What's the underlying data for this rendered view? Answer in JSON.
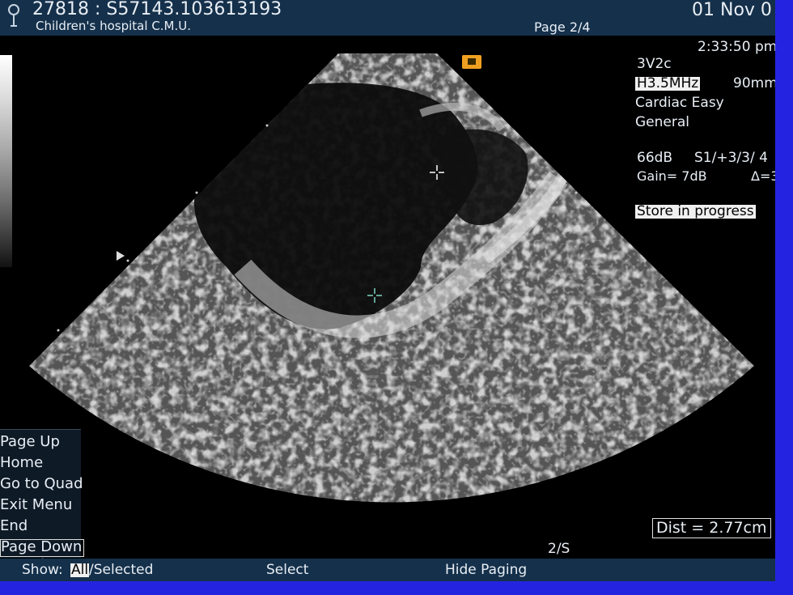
{
  "header": {
    "patient_id": "27818 : S57143.103613193",
    "institution": "Children's hospital  C.M.U.",
    "page": "Page 2/4",
    "date": "01 Nov 0",
    "time": "2:33:50 pm"
  },
  "settings": {
    "probe": "3V2c",
    "freq": "H3.5MHz",
    "depth": "90mm",
    "preset": "Cardiac Easy",
    "mode": "General",
    "db": "66dB",
    "s_param": "S1/+3/3/ 4",
    "gain": "Gain=  7dB",
    "delta": "Δ=3",
    "store": "Store in progress"
  },
  "menu": {
    "items": [
      "Page Up",
      "Home",
      "Go to Quad",
      "Exit Menu",
      "End",
      "Page Down"
    ]
  },
  "measurement": {
    "dist": "Dist = 2.77cm",
    "marker": "2/S"
  },
  "footer": {
    "show_prefix": "Show: ",
    "show_all": "All",
    "show_selected": "/Selected",
    "select": "Select",
    "hide_paging": "Hide Paging"
  },
  "colors": {
    "border": "#2424e0",
    "bar": "#15304a",
    "caliper": "#7cd6c0",
    "marker_icon": "#f0a020"
  }
}
